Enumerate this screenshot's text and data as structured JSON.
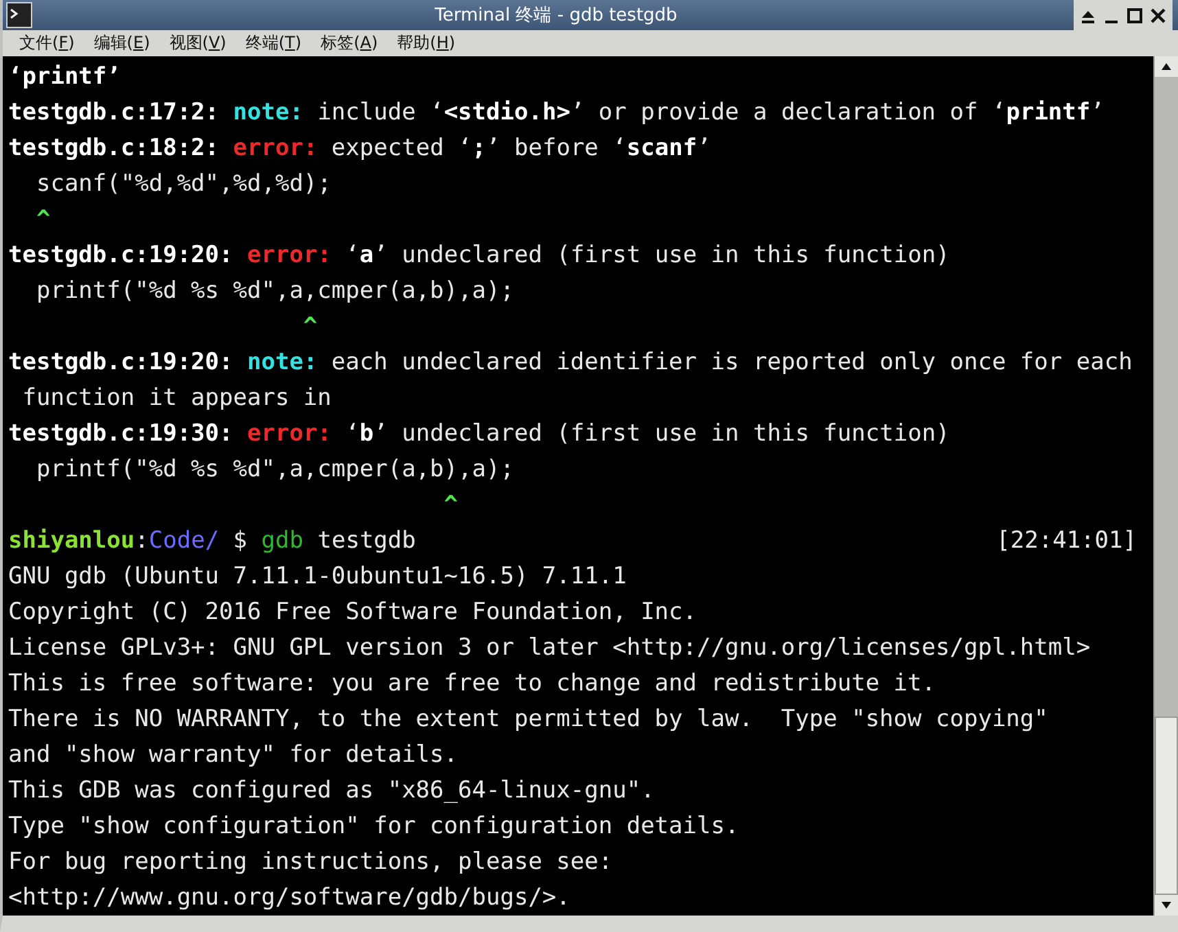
{
  "window": {
    "title": "Terminal 终端 - gdb testgdb"
  },
  "menu": [
    "文件(F)",
    "编辑(E)",
    "视图(V)",
    "终端(T)",
    "标签(A)",
    "帮助(H)"
  ],
  "terminal": {
    "lines": [
      {
        "segments": [
          {
            "kind": "bold",
            "text": "‘printf’"
          }
        ]
      },
      {
        "segments": [
          {
            "kind": "bold",
            "text": "testgdb.c:17:2: "
          },
          {
            "kind": "note",
            "text": "note:"
          },
          {
            "kind": "text",
            "text": " include ‘"
          },
          {
            "kind": "bold",
            "text": "<stdio.h>"
          },
          {
            "kind": "text",
            "text": "’ or provide a declaration of ‘"
          },
          {
            "kind": "bold",
            "text": "printf"
          },
          {
            "kind": "text",
            "text": "’"
          }
        ]
      },
      {
        "segments": [
          {
            "kind": "bold",
            "text": "testgdb.c:18:2: "
          },
          {
            "kind": "error",
            "text": "error:"
          },
          {
            "kind": "text",
            "text": " expected ‘"
          },
          {
            "kind": "bold",
            "text": ";"
          },
          {
            "kind": "text",
            "text": "’ before ‘"
          },
          {
            "kind": "bold",
            "text": "scanf"
          },
          {
            "kind": "text",
            "text": "’"
          }
        ]
      },
      {
        "segments": [
          {
            "kind": "text",
            "text": "  scanf(\"%d,%d\",%d,%d);"
          }
        ]
      },
      {
        "segments": [
          {
            "kind": "caret",
            "text": "  ^"
          }
        ]
      },
      {
        "segments": [
          {
            "kind": "bold",
            "text": "testgdb.c:19:20: "
          },
          {
            "kind": "error",
            "text": "error:"
          },
          {
            "kind": "text",
            "text": " ‘"
          },
          {
            "kind": "bold",
            "text": "a"
          },
          {
            "kind": "text",
            "text": "’ undeclared (first use in this function)"
          }
        ]
      },
      {
        "segments": [
          {
            "kind": "text",
            "text": "  printf(\"%d %s %d\",a,cmper(a,b),a);"
          }
        ]
      },
      {
        "segments": [
          {
            "kind": "caret",
            "text": "                     ^"
          }
        ]
      },
      {
        "segments": [
          {
            "kind": "bold",
            "text": "testgdb.c:19:20: "
          },
          {
            "kind": "note",
            "text": "note:"
          },
          {
            "kind": "text",
            "text": " each undeclared identifier is reported only once for each"
          }
        ]
      },
      {
        "segments": [
          {
            "kind": "text",
            "text": " function it appears in"
          }
        ]
      },
      {
        "segments": [
          {
            "kind": "bold",
            "text": "testgdb.c:19:30: "
          },
          {
            "kind": "error",
            "text": "error:"
          },
          {
            "kind": "text",
            "text": " ‘"
          },
          {
            "kind": "bold",
            "text": "b"
          },
          {
            "kind": "text",
            "text": "’ undeclared (first use in this function)"
          }
        ]
      },
      {
        "segments": [
          {
            "kind": "text",
            "text": "  printf(\"%d %s %d\",a,cmper(a,b),a);"
          }
        ]
      },
      {
        "segments": [
          {
            "kind": "caret",
            "text": "                               ^"
          }
        ]
      },
      {
        "segments": [
          {
            "kind": "user",
            "text": "shiyanlou"
          },
          {
            "kind": "text",
            "text": ":"
          },
          {
            "kind": "path",
            "text": "Code/"
          },
          {
            "kind": "text",
            "text": " $ "
          },
          {
            "kind": "command",
            "text": "gdb"
          },
          {
            "kind": "text",
            "text": " testgdb"
          }
        ],
        "timestamp": "[22:41:01]"
      },
      {
        "segments": [
          {
            "kind": "text",
            "text": "GNU gdb (Ubuntu 7.11.1-0ubuntu1~16.5) 7.11.1"
          }
        ]
      },
      {
        "segments": [
          {
            "kind": "text",
            "text": "Copyright (C) 2016 Free Software Foundation, Inc."
          }
        ]
      },
      {
        "segments": [
          {
            "kind": "text",
            "text": "License GPLv3+: GNU GPL version 3 or later <http://gnu.org/licenses/gpl.html>"
          }
        ]
      },
      {
        "segments": [
          {
            "kind": "text",
            "text": "This is free software: you are free to change and redistribute it."
          }
        ]
      },
      {
        "segments": [
          {
            "kind": "text",
            "text": "There is NO WARRANTY, to the extent permitted by law.  Type \"show copying\""
          }
        ]
      },
      {
        "segments": [
          {
            "kind": "text",
            "text": "and \"show warranty\" for details."
          }
        ]
      },
      {
        "segments": [
          {
            "kind": "text",
            "text": "This GDB was configured as \"x86_64-linux-gnu\"."
          }
        ]
      },
      {
        "segments": [
          {
            "kind": "text",
            "text": "Type \"show configuration\" for configuration details."
          }
        ]
      },
      {
        "segments": [
          {
            "kind": "text",
            "text": "For bug reporting instructions, please see:"
          }
        ]
      },
      {
        "segments": [
          {
            "kind": "text",
            "text": "<http://www.gnu.org/software/gdb/bugs/>."
          }
        ]
      }
    ]
  }
}
